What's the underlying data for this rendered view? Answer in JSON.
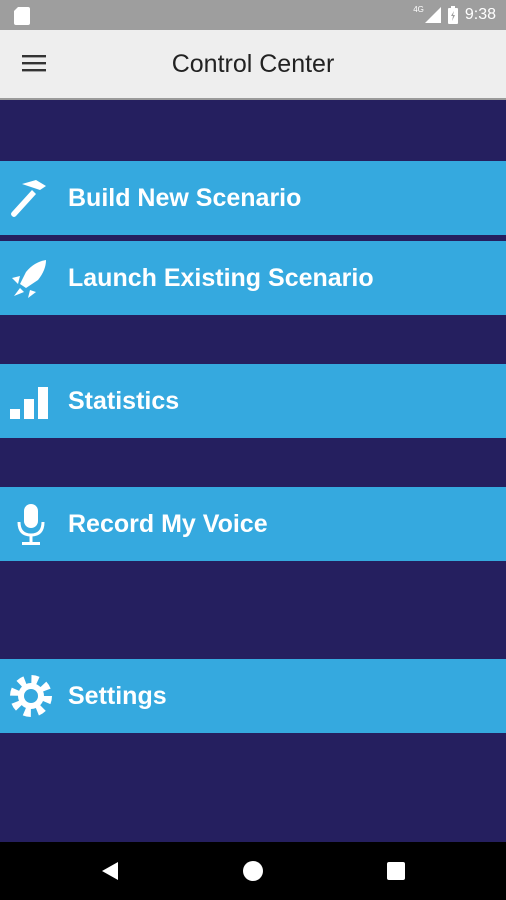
{
  "status_bar": {
    "network_type": "4G",
    "time": "9:38"
  },
  "app_bar": {
    "title": "Control Center"
  },
  "menu": [
    {
      "label": "Build New Scenario",
      "icon": "hammer-icon"
    },
    {
      "label": "Launch Existing Scenario",
      "icon": "rocket-icon"
    },
    {
      "label": "Statistics",
      "icon": "bar-chart-icon"
    },
    {
      "label": "Record My Voice",
      "icon": "microphone-icon"
    },
    {
      "label": "Settings",
      "icon": "gear-icon"
    }
  ],
  "colors": {
    "background": "#251f5f",
    "menu_row": "#35a9df",
    "app_bar": "#eeeeee",
    "status_bar": "#9e9e9e",
    "nav_bar": "#000000"
  }
}
